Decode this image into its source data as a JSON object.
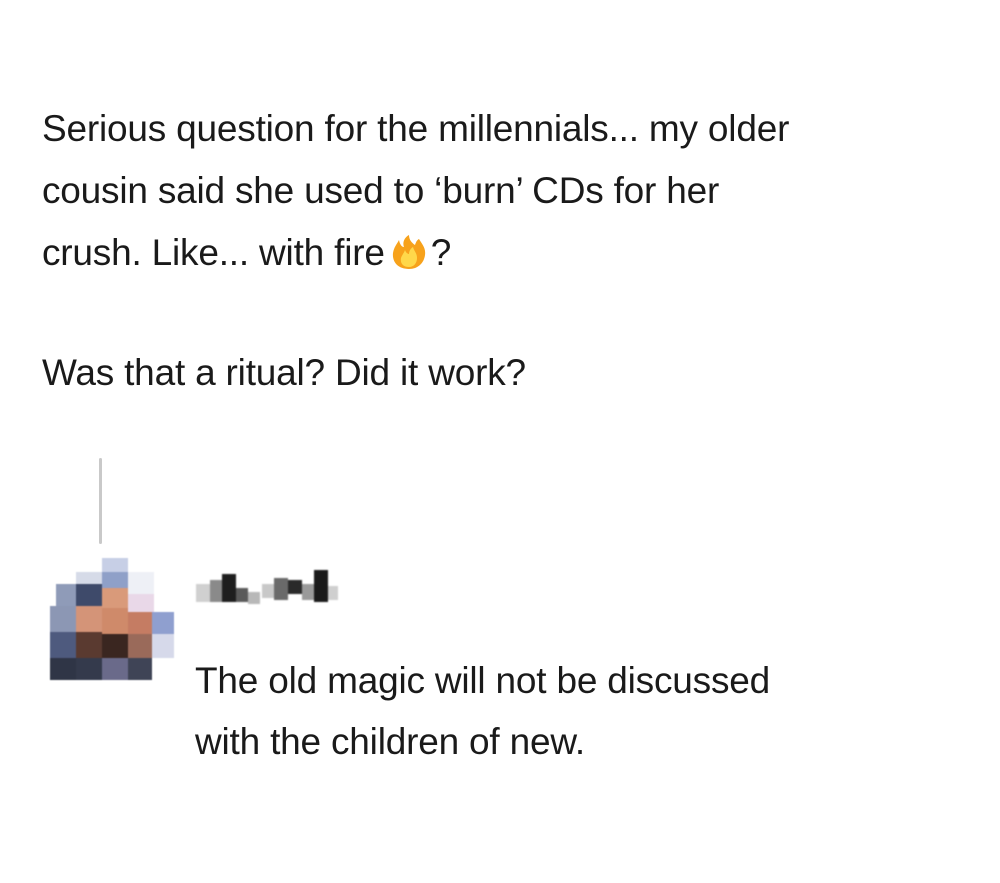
{
  "post": {
    "lines": [
      "Serious question for the millennials... my older",
      "cousin said she used to ‘burn’ CDs for her",
      "crush. Like... with fire",
      "?"
    ],
    "second_paragraph": "Was that a ritual? Did it work?",
    "emoji_icon": "fire-emoji-icon"
  },
  "reply": {
    "avatar_icon": "pixelated-avatar",
    "username_icon": "pixelated-username",
    "lines": [
      "The old magic will not be discussed",
      "with the children of new."
    ]
  },
  "colors": {
    "text": "#1a1a1a",
    "thread_line": "#c9c9c9",
    "background": "#ffffff",
    "fire_outer": "#f7a21b",
    "fire_inner": "#ffd84a"
  }
}
